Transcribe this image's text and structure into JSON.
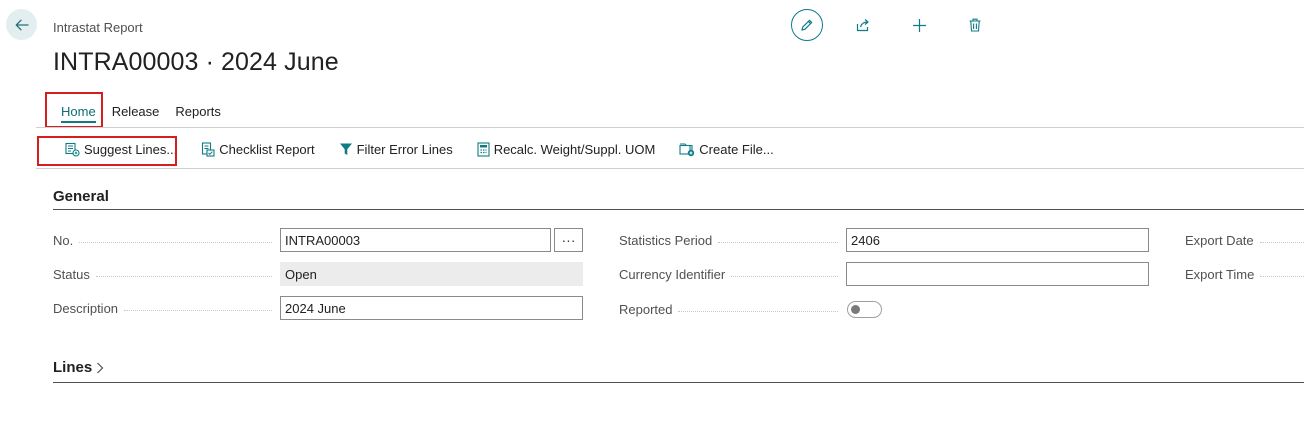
{
  "header": {
    "breadcrumb": "Intrastat Report",
    "title": "INTRA00003 · 2024 June"
  },
  "tabs": [
    {
      "label": "Home",
      "active": true
    },
    {
      "label": "Release"
    },
    {
      "label": "Reports"
    }
  ],
  "actions": [
    {
      "label": "Suggest Lines...",
      "icon": "suggest-lines-icon"
    },
    {
      "label": "Checklist Report",
      "icon": "checklist-icon"
    },
    {
      "label": "Filter Error Lines",
      "icon": "filter-icon"
    },
    {
      "label": "Recalc. Weight/Suppl. UOM",
      "icon": "recalc-icon"
    },
    {
      "label": "Create File...",
      "icon": "create-file-icon"
    }
  ],
  "general": {
    "title": "General",
    "no_label": "No.",
    "no_value": "INTRA00003",
    "more_label": "···",
    "status_label": "Status",
    "status_value": "Open",
    "description_label": "Description",
    "description_value": "2024 June",
    "statistics_period_label": "Statistics Period",
    "statistics_period_value": "2406",
    "currency_identifier_label": "Currency Identifier",
    "currency_identifier_value": "",
    "reported_label": "Reported",
    "reported_value": false,
    "export_date_label": "Export Date",
    "export_time_label": "Export Time"
  },
  "lines": {
    "title": "Lines"
  },
  "colors": {
    "accent": "#0f7b86",
    "highlight": "#d51f1f"
  }
}
